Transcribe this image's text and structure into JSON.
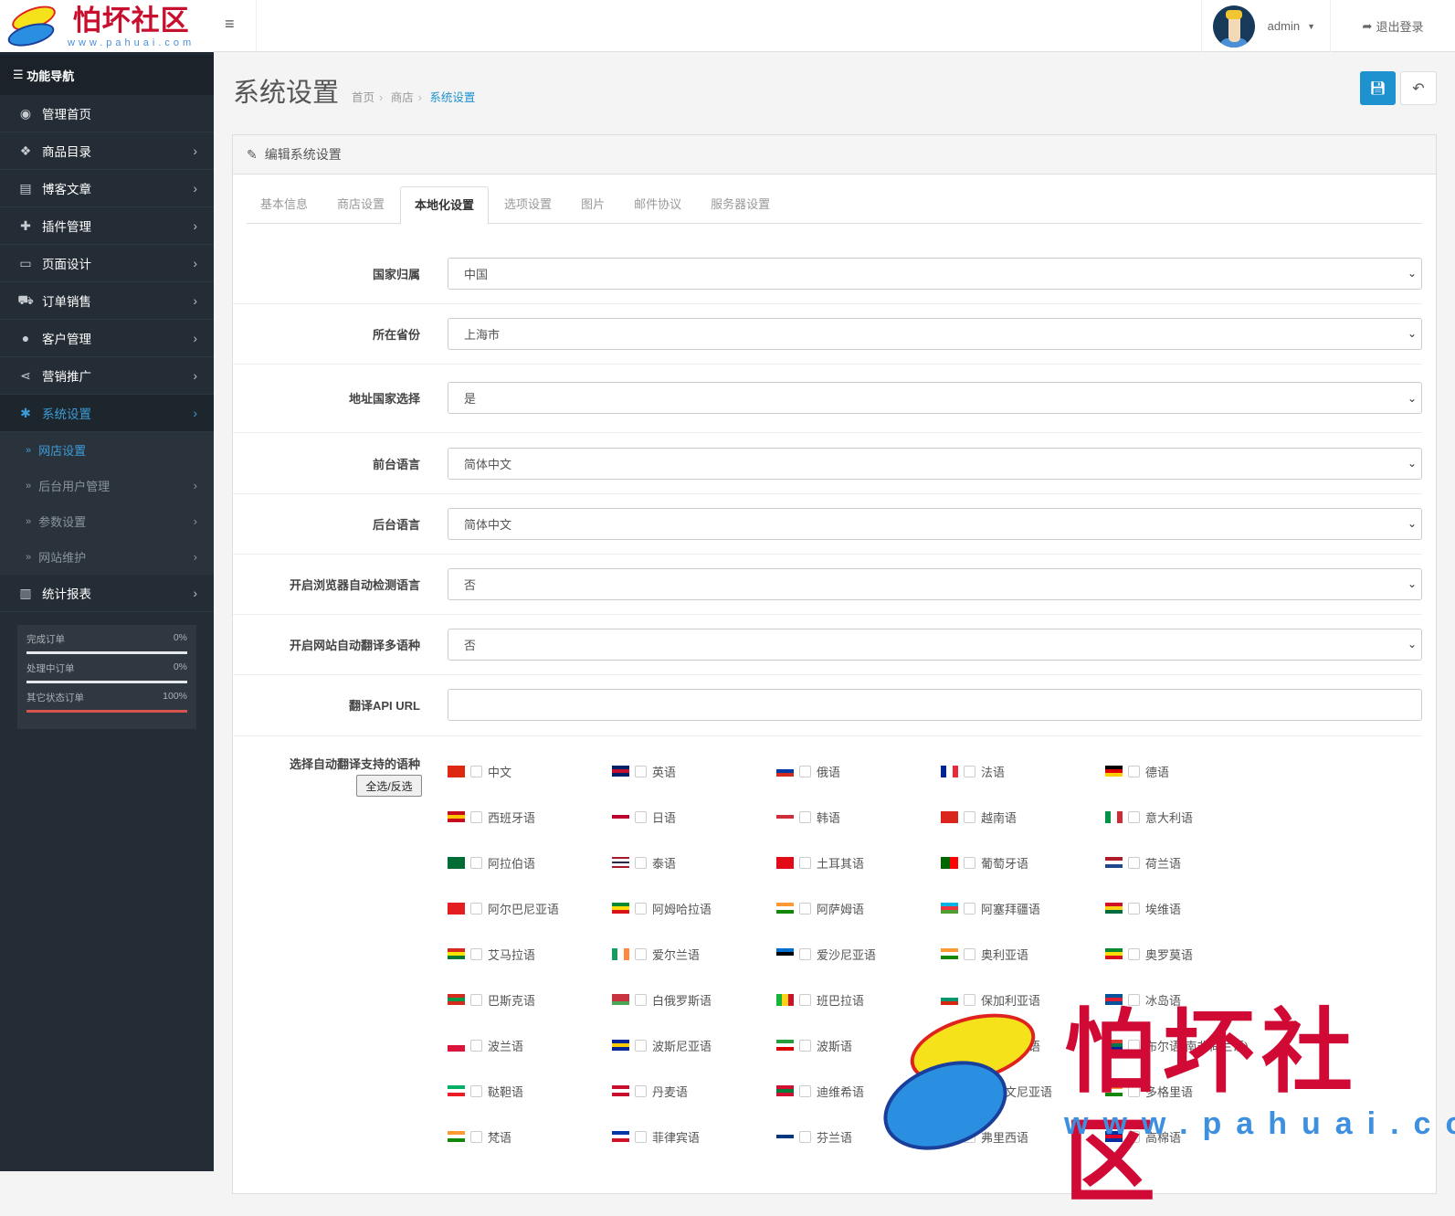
{
  "logo": {
    "title": "怕坏社区",
    "url": "www.pahuai.com"
  },
  "sidebar": {
    "heading": "功能导航",
    "items": [
      {
        "label": "管理首页",
        "icon": "dashboard-icon",
        "glyph": "◉"
      },
      {
        "label": "商品目录",
        "icon": "tags-icon",
        "glyph": "❖"
      },
      {
        "label": "博客文章",
        "icon": "newspaper-icon",
        "glyph": "▤"
      },
      {
        "label": "插件管理",
        "icon": "puzzle-icon",
        "glyph": "✚"
      },
      {
        "label": "页面设计",
        "icon": "desktop-icon",
        "glyph": "▭"
      },
      {
        "label": "订单销售",
        "icon": "cart-icon",
        "glyph": "⛟"
      },
      {
        "label": "客户管理",
        "icon": "user-icon",
        "glyph": "●"
      },
      {
        "label": "营销推广",
        "icon": "share-icon",
        "glyph": "⋖"
      },
      {
        "label": "系统设置",
        "icon": "gear-icon",
        "glyph": "✱"
      }
    ],
    "subitems": [
      {
        "label": "网店设置"
      },
      {
        "label": "后台用户管理"
      },
      {
        "label": "参数设置"
      },
      {
        "label": "网站维护"
      }
    ],
    "last_item": {
      "label": "统计报表",
      "icon": "bar-chart-icon",
      "glyph": "▥"
    },
    "stats": [
      {
        "label": "完成订单",
        "value": "0%",
        "percent": 0
      },
      {
        "label": "处理中订单",
        "value": "0%",
        "percent": 0
      },
      {
        "label": "其它状态订单",
        "value": "100%",
        "percent": 100
      }
    ]
  },
  "header": {
    "user": "admin",
    "logout": "退出登录"
  },
  "page": {
    "title": "系统设置",
    "breadcrumb": [
      "首页",
      "商店",
      "系统设置"
    ]
  },
  "panel": {
    "title": "编辑系统设置",
    "tabs": [
      "基本信息",
      "商店设置",
      "本地化设置",
      "选项设置",
      "图片",
      "邮件协议",
      "服务器设置"
    ],
    "active_tab": 2,
    "fields": [
      {
        "label": "国家归属",
        "value": "中国",
        "type": "select"
      },
      {
        "label": "所在省份",
        "value": "上海市",
        "type": "select"
      },
      {
        "label": "地址国家选择",
        "value": "是",
        "type": "select"
      },
      {
        "label": "前台语言",
        "value": "简体中文",
        "type": "select"
      },
      {
        "label": "后台语言",
        "value": "简体中文",
        "type": "select"
      },
      {
        "label": "开启浏览器自动检测语言",
        "value": "否",
        "type": "select"
      },
      {
        "label": "开启网站自动翻译多语种",
        "value": "否",
        "type": "select"
      },
      {
        "label": "翻译API URL",
        "value": "",
        "type": "text"
      }
    ],
    "languages_label": "选择自动翻译支持的语种",
    "select_all": "全选/反选",
    "languages": [
      {
        "name": "中文",
        "flag": [
          "#de2910",
          "#de2910"
        ]
      },
      {
        "name": "英语",
        "flag": [
          "#012169",
          "#c8102e",
          "#012169"
        ]
      },
      {
        "name": "俄语",
        "flag": [
          "#ffffff",
          "#0039a6",
          "#d52b1e"
        ]
      },
      {
        "name": "法语",
        "flag": [
          "#002395",
          "#ffffff",
          "#ed2939"
        ],
        "vertical": true
      },
      {
        "name": "德语",
        "flag": [
          "#000000",
          "#dd0000",
          "#ffce00"
        ]
      },
      {
        "name": "西班牙语",
        "flag": [
          "#c60b1e",
          "#ffc400",
          "#c60b1e"
        ]
      },
      {
        "name": "日语",
        "flag": [
          "#ffffff",
          "#bc002d",
          "#ffffff"
        ]
      },
      {
        "name": "韩语",
        "flag": [
          "#ffffff",
          "#cd2e3a",
          "#ffffff"
        ]
      },
      {
        "name": "越南语",
        "flag": [
          "#da251d",
          "#da251d"
        ]
      },
      {
        "name": "意大利语",
        "flag": [
          "#009246",
          "#ffffff",
          "#ce2b37"
        ],
        "vertical": true
      },
      {
        "name": "阿拉伯语",
        "flag": [
          "#006c35",
          "#006c35"
        ]
      },
      {
        "name": "泰语",
        "flag": [
          "#a51931",
          "#f4f5f8",
          "#2d2a4a",
          "#f4f5f8",
          "#a51931"
        ]
      },
      {
        "name": "土耳其语",
        "flag": [
          "#e30a17",
          "#e30a17"
        ]
      },
      {
        "name": "葡萄牙语",
        "flag": [
          "#006600",
          "#ff0000"
        ],
        "vertical": true
      },
      {
        "name": "荷兰语",
        "flag": [
          "#ae1c28",
          "#ffffff",
          "#21468b"
        ]
      },
      {
        "name": "阿尔巴尼亚语",
        "flag": [
          "#e41e20",
          "#e41e20"
        ]
      },
      {
        "name": "阿姆哈拉语",
        "flag": [
          "#078930",
          "#fcdd09",
          "#da121a"
        ]
      },
      {
        "name": "阿萨姆语",
        "flag": [
          "#ff9933",
          "#ffffff",
          "#138808"
        ]
      },
      {
        "name": "阿塞拜疆语",
        "flag": [
          "#00b5e2",
          "#ef3340",
          "#509e2f"
        ]
      },
      {
        "name": "埃维语",
        "flag": [
          "#ce1126",
          "#fcd116",
          "#006b3f"
        ]
      },
      {
        "name": "艾马拉语",
        "flag": [
          "#d52b1e",
          "#f9e300",
          "#007934"
        ]
      },
      {
        "name": "爱尔兰语",
        "flag": [
          "#169b62",
          "#ffffff",
          "#ff883e"
        ],
        "vertical": true
      },
      {
        "name": "爱沙尼亚语",
        "flag": [
          "#0072ce",
          "#000000",
          "#ffffff"
        ]
      },
      {
        "name": "奥利亚语",
        "flag": [
          "#ff9933",
          "#ffffff",
          "#138808"
        ]
      },
      {
        "name": "奥罗莫语",
        "flag": [
          "#078930",
          "#fcdd09",
          "#da121a"
        ]
      },
      {
        "name": "巴斯克语",
        "flag": [
          "#d52b1e",
          "#009b48",
          "#d52b1e"
        ]
      },
      {
        "name": "白俄罗斯语",
        "flag": [
          "#c8313e",
          "#c8313e",
          "#4aa657"
        ]
      },
      {
        "name": "班巴拉语",
        "flag": [
          "#14b53a",
          "#fcd116",
          "#ce1126"
        ],
        "vertical": true
      },
      {
        "name": "保加利亚语",
        "flag": [
          "#ffffff",
          "#00966e",
          "#d62612"
        ]
      },
      {
        "name": "冰岛语",
        "flag": [
          "#02529c",
          "#dc1e35",
          "#02529c"
        ]
      },
      {
        "name": "波兰语",
        "flag": [
          "#ffffff",
          "#dc143c"
        ]
      },
      {
        "name": "波斯尼亚语",
        "flag": [
          "#002395",
          "#fecb00",
          "#002395"
        ]
      },
      {
        "name": "波斯语",
        "flag": [
          "#239f40",
          "#ffffff",
          "#da0000"
        ]
      },
      {
        "name": "博杰普尔语",
        "flag": [
          "#ff9933",
          "#ffffff",
          "#138808"
        ]
      },
      {
        "name": "布尔语(南非荷兰语)",
        "flag": [
          "#de3831",
          "#007a4d",
          "#002395"
        ]
      },
      {
        "name": "鞑靼语",
        "flag": [
          "#00af66",
          "#ffffff",
          "#ed1c24"
        ]
      },
      {
        "name": "丹麦语",
        "flag": [
          "#c8102e",
          "#ffffff",
          "#c8102e"
        ]
      },
      {
        "name": "迪维希语",
        "flag": [
          "#d21034",
          "#007e3a",
          "#d21034"
        ]
      },
      {
        "name": "斯洛文尼亚语",
        "flag": [
          "#ffffff",
          "#0000ff",
          "#ff0000"
        ]
      },
      {
        "name": "多格里语",
        "flag": [
          "#ff9933",
          "#ffffff",
          "#138808"
        ]
      },
      {
        "name": "梵语",
        "flag": [
          "#ff9933",
          "#ffffff",
          "#138808"
        ]
      },
      {
        "name": "菲律宾语",
        "flag": [
          "#0038a8",
          "#ffffff",
          "#ce1126"
        ]
      },
      {
        "name": "芬兰语",
        "flag": [
          "#ffffff",
          "#003580",
          "#ffffff"
        ]
      },
      {
        "name": "弗里西语",
        "flag": [
          "#1b4e9b",
          "#ffffff",
          "#1b4e9b"
        ]
      },
      {
        "name": "高棉语",
        "flag": [
          "#032ea1",
          "#e00025",
          "#032ea1"
        ]
      }
    ]
  },
  "colors": {
    "accent": "#1e91cf",
    "sidebar": "#242d36",
    "danger": "#d9534f"
  }
}
